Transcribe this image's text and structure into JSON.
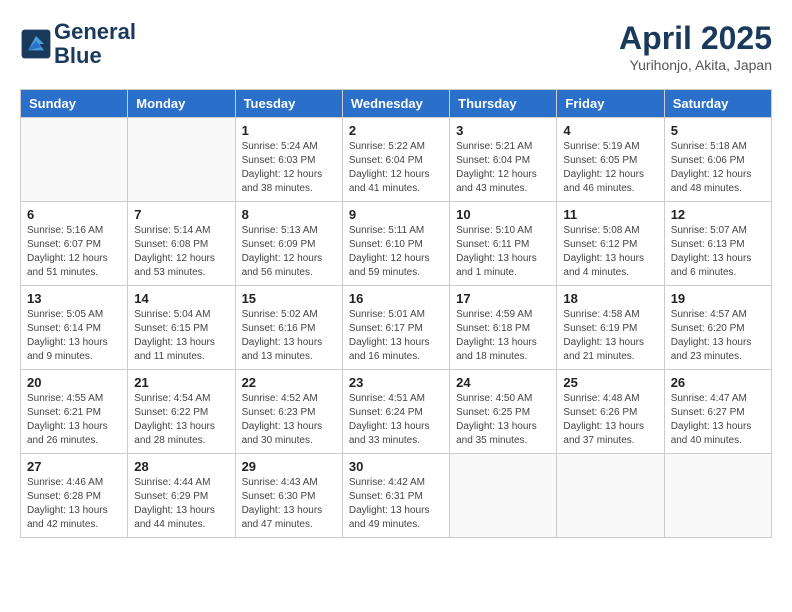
{
  "header": {
    "logo_line1": "General",
    "logo_line2": "Blue",
    "month_year": "April 2025",
    "location": "Yurihonjo, Akita, Japan"
  },
  "weekdays": [
    "Sunday",
    "Monday",
    "Tuesday",
    "Wednesday",
    "Thursday",
    "Friday",
    "Saturday"
  ],
  "weeks": [
    [
      {
        "day": "",
        "info": ""
      },
      {
        "day": "",
        "info": ""
      },
      {
        "day": "1",
        "info": "Sunrise: 5:24 AM\nSunset: 6:03 PM\nDaylight: 12 hours\nand 38 minutes."
      },
      {
        "day": "2",
        "info": "Sunrise: 5:22 AM\nSunset: 6:04 PM\nDaylight: 12 hours\nand 41 minutes."
      },
      {
        "day": "3",
        "info": "Sunrise: 5:21 AM\nSunset: 6:04 PM\nDaylight: 12 hours\nand 43 minutes."
      },
      {
        "day": "4",
        "info": "Sunrise: 5:19 AM\nSunset: 6:05 PM\nDaylight: 12 hours\nand 46 minutes."
      },
      {
        "day": "5",
        "info": "Sunrise: 5:18 AM\nSunset: 6:06 PM\nDaylight: 12 hours\nand 48 minutes."
      }
    ],
    [
      {
        "day": "6",
        "info": "Sunrise: 5:16 AM\nSunset: 6:07 PM\nDaylight: 12 hours\nand 51 minutes."
      },
      {
        "day": "7",
        "info": "Sunrise: 5:14 AM\nSunset: 6:08 PM\nDaylight: 12 hours\nand 53 minutes."
      },
      {
        "day": "8",
        "info": "Sunrise: 5:13 AM\nSunset: 6:09 PM\nDaylight: 12 hours\nand 56 minutes."
      },
      {
        "day": "9",
        "info": "Sunrise: 5:11 AM\nSunset: 6:10 PM\nDaylight: 12 hours\nand 59 minutes."
      },
      {
        "day": "10",
        "info": "Sunrise: 5:10 AM\nSunset: 6:11 PM\nDaylight: 13 hours\nand 1 minute."
      },
      {
        "day": "11",
        "info": "Sunrise: 5:08 AM\nSunset: 6:12 PM\nDaylight: 13 hours\nand 4 minutes."
      },
      {
        "day": "12",
        "info": "Sunrise: 5:07 AM\nSunset: 6:13 PM\nDaylight: 13 hours\nand 6 minutes."
      }
    ],
    [
      {
        "day": "13",
        "info": "Sunrise: 5:05 AM\nSunset: 6:14 PM\nDaylight: 13 hours\nand 9 minutes."
      },
      {
        "day": "14",
        "info": "Sunrise: 5:04 AM\nSunset: 6:15 PM\nDaylight: 13 hours\nand 11 minutes."
      },
      {
        "day": "15",
        "info": "Sunrise: 5:02 AM\nSunset: 6:16 PM\nDaylight: 13 hours\nand 13 minutes."
      },
      {
        "day": "16",
        "info": "Sunrise: 5:01 AM\nSunset: 6:17 PM\nDaylight: 13 hours\nand 16 minutes."
      },
      {
        "day": "17",
        "info": "Sunrise: 4:59 AM\nSunset: 6:18 PM\nDaylight: 13 hours\nand 18 minutes."
      },
      {
        "day": "18",
        "info": "Sunrise: 4:58 AM\nSunset: 6:19 PM\nDaylight: 13 hours\nand 21 minutes."
      },
      {
        "day": "19",
        "info": "Sunrise: 4:57 AM\nSunset: 6:20 PM\nDaylight: 13 hours\nand 23 minutes."
      }
    ],
    [
      {
        "day": "20",
        "info": "Sunrise: 4:55 AM\nSunset: 6:21 PM\nDaylight: 13 hours\nand 26 minutes."
      },
      {
        "day": "21",
        "info": "Sunrise: 4:54 AM\nSunset: 6:22 PM\nDaylight: 13 hours\nand 28 minutes."
      },
      {
        "day": "22",
        "info": "Sunrise: 4:52 AM\nSunset: 6:23 PM\nDaylight: 13 hours\nand 30 minutes."
      },
      {
        "day": "23",
        "info": "Sunrise: 4:51 AM\nSunset: 6:24 PM\nDaylight: 13 hours\nand 33 minutes."
      },
      {
        "day": "24",
        "info": "Sunrise: 4:50 AM\nSunset: 6:25 PM\nDaylight: 13 hours\nand 35 minutes."
      },
      {
        "day": "25",
        "info": "Sunrise: 4:48 AM\nSunset: 6:26 PM\nDaylight: 13 hours\nand 37 minutes."
      },
      {
        "day": "26",
        "info": "Sunrise: 4:47 AM\nSunset: 6:27 PM\nDaylight: 13 hours\nand 40 minutes."
      }
    ],
    [
      {
        "day": "27",
        "info": "Sunrise: 4:46 AM\nSunset: 6:28 PM\nDaylight: 13 hours\nand 42 minutes."
      },
      {
        "day": "28",
        "info": "Sunrise: 4:44 AM\nSunset: 6:29 PM\nDaylight: 13 hours\nand 44 minutes."
      },
      {
        "day": "29",
        "info": "Sunrise: 4:43 AM\nSunset: 6:30 PM\nDaylight: 13 hours\nand 47 minutes."
      },
      {
        "day": "30",
        "info": "Sunrise: 4:42 AM\nSunset: 6:31 PM\nDaylight: 13 hours\nand 49 minutes."
      },
      {
        "day": "",
        "info": ""
      },
      {
        "day": "",
        "info": ""
      },
      {
        "day": "",
        "info": ""
      }
    ]
  ]
}
